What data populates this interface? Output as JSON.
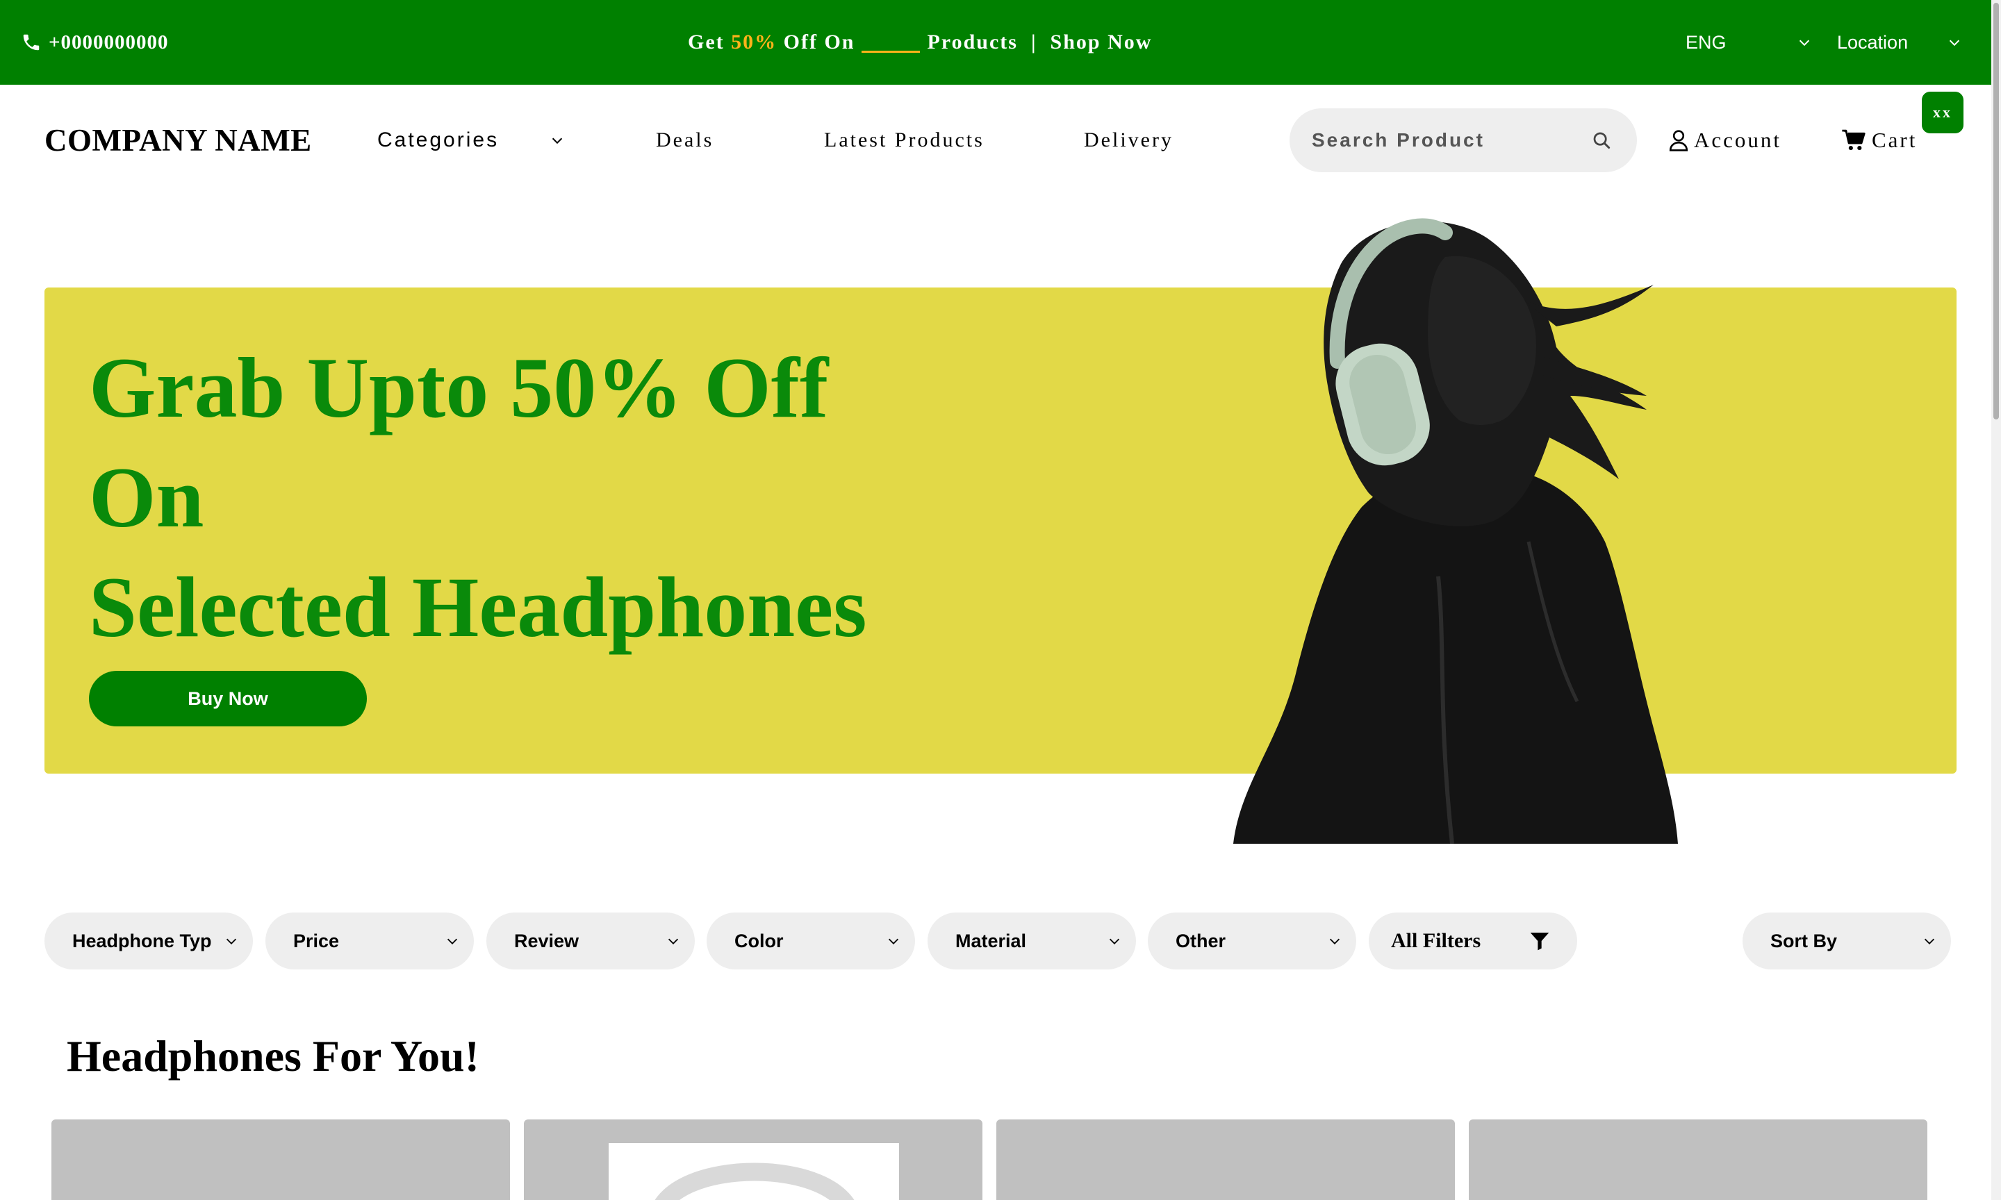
{
  "topbar": {
    "phone": "+0000000000",
    "promo": {
      "get": "Get ",
      "percent": "50%",
      "off_on": " Off On",
      "products": "Products",
      "separator": "  |  ",
      "shop_now": "Shop Now"
    },
    "language": "ENG",
    "location": "Location"
  },
  "header": {
    "company": "COMPANY NAME",
    "nav": {
      "categories": "Categories",
      "deals": "Deals",
      "latest": "Latest Products",
      "delivery": "Delivery"
    },
    "search_placeholder": "Search Product",
    "account": "Account",
    "cart": "Cart",
    "cart_badge": "xx"
  },
  "hero": {
    "line1": "Grab Upto 50% Off",
    "line2": "On",
    "line3": "Selected Headphones",
    "cta": "Buy Now"
  },
  "filters": [
    "Headphone Type",
    "Price",
    "Review",
    "Color",
    "Material",
    "Other",
    "All Filters",
    "Sort By"
  ],
  "products": {
    "title": "Headphones For You!"
  },
  "colors": {
    "brand_green": "#008000",
    "hero_yellow": "#e2d947",
    "hero_text_green": "#0a8a0a",
    "promo_highlight": "#ffb31a"
  }
}
